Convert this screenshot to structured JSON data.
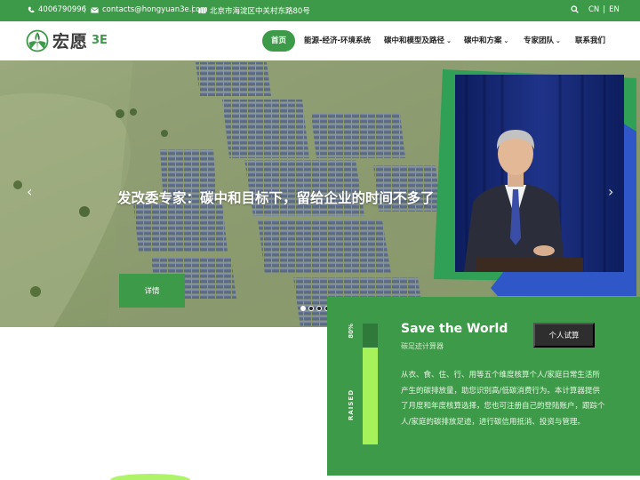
{
  "topbar": {
    "phone": "4006790996",
    "email": "contacts@hongyuan3e.com",
    "address": "北京市海淀区中关村东路80号",
    "lang_cn": "CN",
    "lang_sep": "|",
    "lang_en": "EN"
  },
  "logo": {
    "text": "宏愿",
    "suffix": "3E"
  },
  "nav": {
    "items": [
      {
        "label": "首页",
        "active": true
      },
      {
        "label": "能源-经济-环境系统"
      },
      {
        "label": "碳中和模型及路径"
      },
      {
        "label": "碳中和方案"
      },
      {
        "label": "专家团队"
      },
      {
        "label": "联系我们"
      }
    ],
    "dropdown_chevron": "⌄"
  },
  "hero": {
    "title": "发改委专家：碳中和目标下，留给企业的时间不多了",
    "button_label": "详情",
    "arrow_prev": "‹",
    "arrow_next": "›",
    "active_slide": 0,
    "slide_count": 4
  },
  "panel": {
    "title": "Save the World",
    "subtitle": "碳足迹计算器",
    "button_label": "个人试算",
    "description": "从衣、食、住、行、用等五个维度核算个人/家庭日常生活所产生的碳排放量，助您识别高/低碳消费行为。本计算器提供了月度和年度核算选择，您也可注册自己的登陆账户，跟踪个人/家庭的碳排放足迹，进行碳信用抵消、投资与管理。",
    "progress_percent": 80,
    "progress_label": "80%",
    "progress_caption": "RAISED"
  },
  "colors": {
    "brand_green": "#3d9a48",
    "accent_lime": "#a6f25a",
    "dark_button": "#2e2e2e"
  },
  "icons": {
    "phone": "phone-icon",
    "email": "envelope-icon",
    "address": "map-icon",
    "search": "search-icon"
  }
}
